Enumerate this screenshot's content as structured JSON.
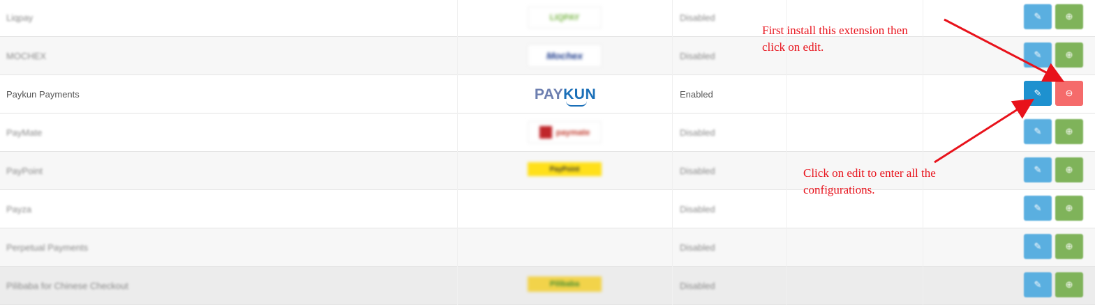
{
  "rows": [
    {
      "name": "Liqpay",
      "logo": "LIQPAY",
      "status": "Disabled"
    },
    {
      "name": "MOCHEX",
      "logo": "Mochex",
      "status": "Disabled"
    },
    {
      "name": "Paykun Payments",
      "logo_part1": "PAY",
      "logo_part2": "KUN",
      "status": "Enabled"
    },
    {
      "name": "PayMate",
      "logo": "paymate",
      "status": "Disabled"
    },
    {
      "name": "PayPoint",
      "logo": "PayPoint",
      "status": "Disabled"
    },
    {
      "name": "Payza",
      "status": "Disabled"
    },
    {
      "name": "Perpetual Payments",
      "status": "Disabled"
    },
    {
      "name": "Pilibaba for Chinese Checkout",
      "logo": "Pilibaba",
      "status": "Disabled"
    }
  ],
  "icons": {
    "edit": "pencil-icon",
    "install": "plus-circle-icon",
    "uninstall": "minus-circle-icon"
  },
  "colors": {
    "edit_button": "#1e91cf",
    "install_button": "#8fbf6a",
    "uninstall_button": "#f56b6b",
    "annotation": "#e8121b"
  },
  "annotations": {
    "install_note_line1": "First install this extension then",
    "install_note_line2": "click on edit.",
    "edit_note_line1": "Click on edit to enter all the",
    "edit_note_line2": "configurations."
  }
}
